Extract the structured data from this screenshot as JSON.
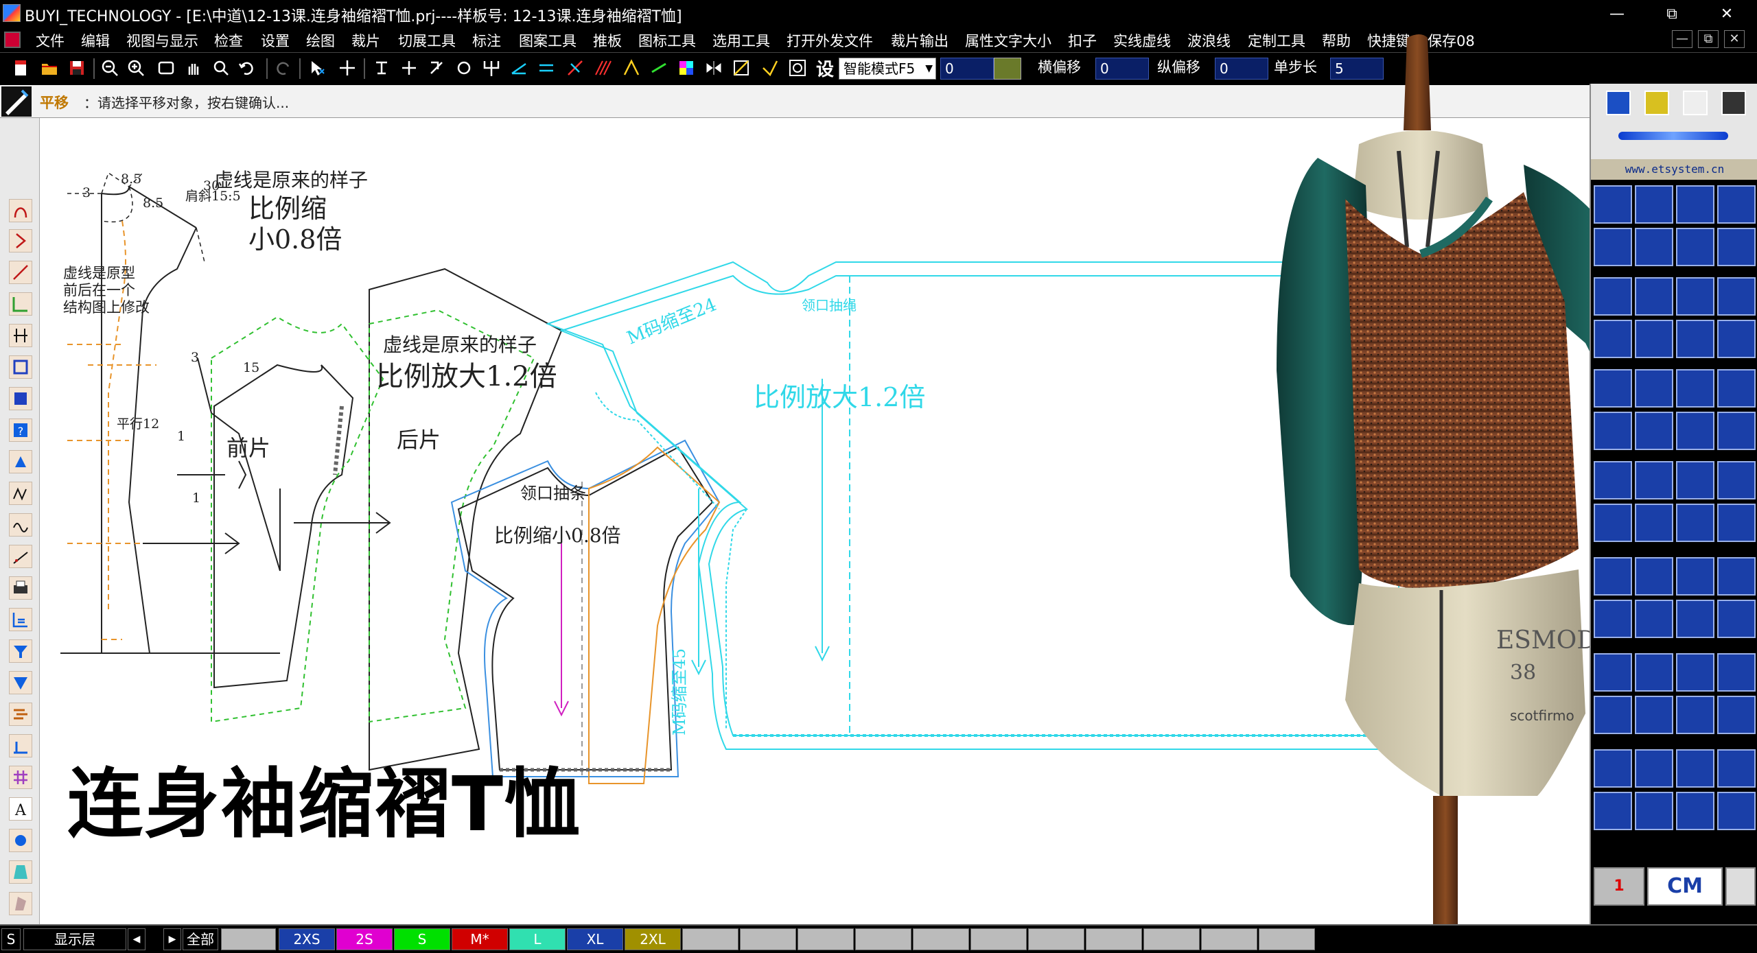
{
  "window": {
    "title": "BUYI_TECHNOLOGY - [E:\\中道\\12-13课.连身袖缩褶T恤.prj----样板号: 12-13课.连身袖缩褶T恤]",
    "minimize": "—",
    "maximize": "⧉",
    "close": "✕"
  },
  "menu": [
    "文件",
    "编辑",
    "视图与显示",
    "检查",
    "设置",
    "绘图",
    "裁片",
    "切展工具",
    "标注",
    "图案工具",
    "推板",
    "图标工具",
    "选用工具",
    "打开外发文件",
    "裁片输出",
    "属性文字大小",
    "扣子",
    "实线虚线",
    "波浪线",
    "定制工具",
    "帮助",
    "快捷键",
    "保存08"
  ],
  "mdi": {
    "minimize": "—",
    "restore": "⧉",
    "close": "✕"
  },
  "toolbar": {
    "set_label": "设",
    "mode": "智能模式F5",
    "field_0": "0",
    "h_offset_label": "横偏移",
    "h_offset": "0",
    "v_offset_label": "纵偏移",
    "v_offset": "0",
    "step_label": "单步长",
    "step": "5"
  },
  "prompt": {
    "command": "平移",
    "message": "：请选择平移对象，按右键确认..."
  },
  "canvas": {
    "title": "连身袖缩褶T恤",
    "annotations": {
      "d1": "8.5",
      "d2": "30",
      "d3": "3",
      "d4": "8.5",
      "d5": "肩斜15:5",
      "d6": "15",
      "d7": "3",
      "d8": "1",
      "d9": "1",
      "d10": "平行12",
      "note_prototype": [
        "虚线是原型",
        "前后在一个",
        "结构图上修改"
      ],
      "front_note1": "虚线是原来的样子",
      "front_note2": "比例缩",
      "front_note3": "小0.8倍",
      "front_label": "前片",
      "back_note1": "虚线是原来的样子",
      "back_note2": "比例放大1.2倍",
      "back_label": "后片",
      "grade_neck": "领口抽条",
      "grade_small": "比例缩小0.8倍",
      "grade_m24": "M码缩至24",
      "grade_m45": "M码缩至45",
      "grade_big": "比例放大1.2倍",
      "grade_neck2": "领口抽绳"
    }
  },
  "right_panel": {
    "site": "www.etsystem.cn",
    "red_value": "1",
    "unit": "CM"
  },
  "status": {
    "s": "S",
    "layer": "显示层",
    "prev": "◀",
    "next": "▶",
    "all": "全部",
    "sizes": [
      {
        "label": "2XS",
        "color": "#1a3fa8",
        "text": "#ffffff"
      },
      {
        "label": "2S",
        "color": "#e000d0",
        "text": "#ffffff"
      },
      {
        "label": "S",
        "color": "#00e000",
        "text": "#ffffff"
      },
      {
        "label": "M*",
        "color": "#d00000",
        "text": "#ffffff"
      },
      {
        "label": "L",
        "color": "#30e0b0",
        "text": "#ffffff"
      },
      {
        "label": "XL",
        "color": "#1a3fa8",
        "text": "#ffffff"
      },
      {
        "label": "2XL",
        "color": "#a09000",
        "text": "#ffffff"
      }
    ]
  },
  "mannequin": {
    "brand": "ESMOD",
    "size": "38",
    "maker": "scotfirmo"
  }
}
